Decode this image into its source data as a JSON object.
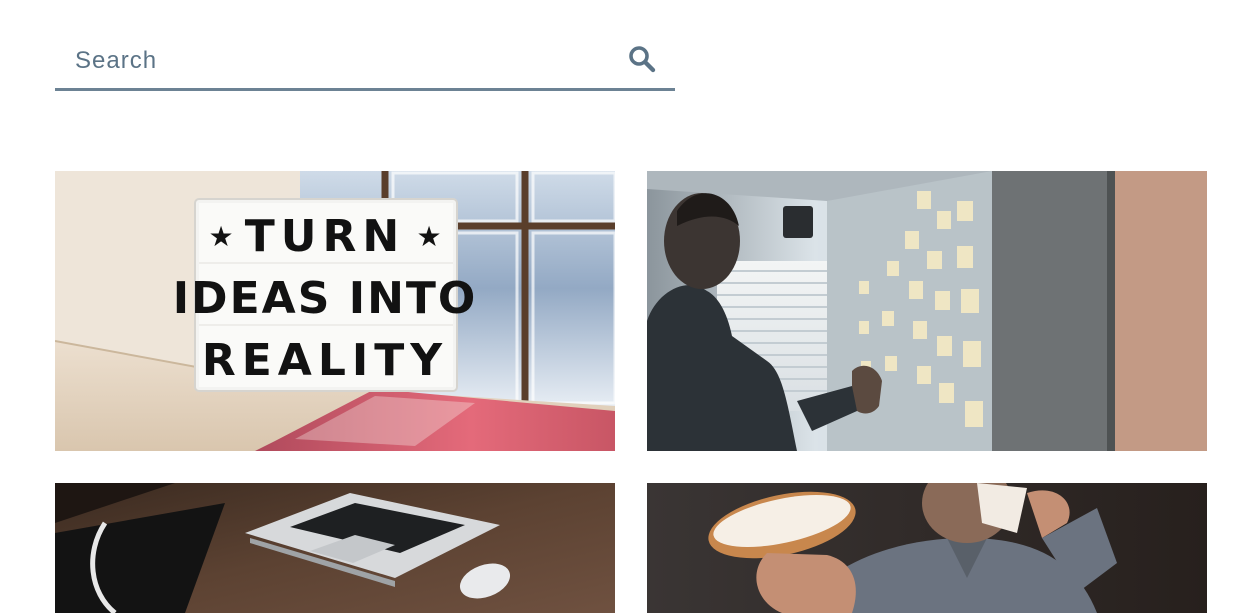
{
  "search": {
    "placeholder": "Search",
    "icon": "search-icon"
  },
  "cards": [
    {
      "image": "lightbox-sign-photo",
      "sign_lines": [
        "TURN",
        "IDEAS INTO",
        "REALITY"
      ]
    },
    {
      "image": "man-at-sticky-note-wall-photo"
    },
    {
      "image": "laptop-on-desk-photo"
    },
    {
      "image": "man-eating-bagel-photo"
    }
  ],
  "colors": {
    "accent": "#6c8294",
    "text": "#5b7386"
  }
}
